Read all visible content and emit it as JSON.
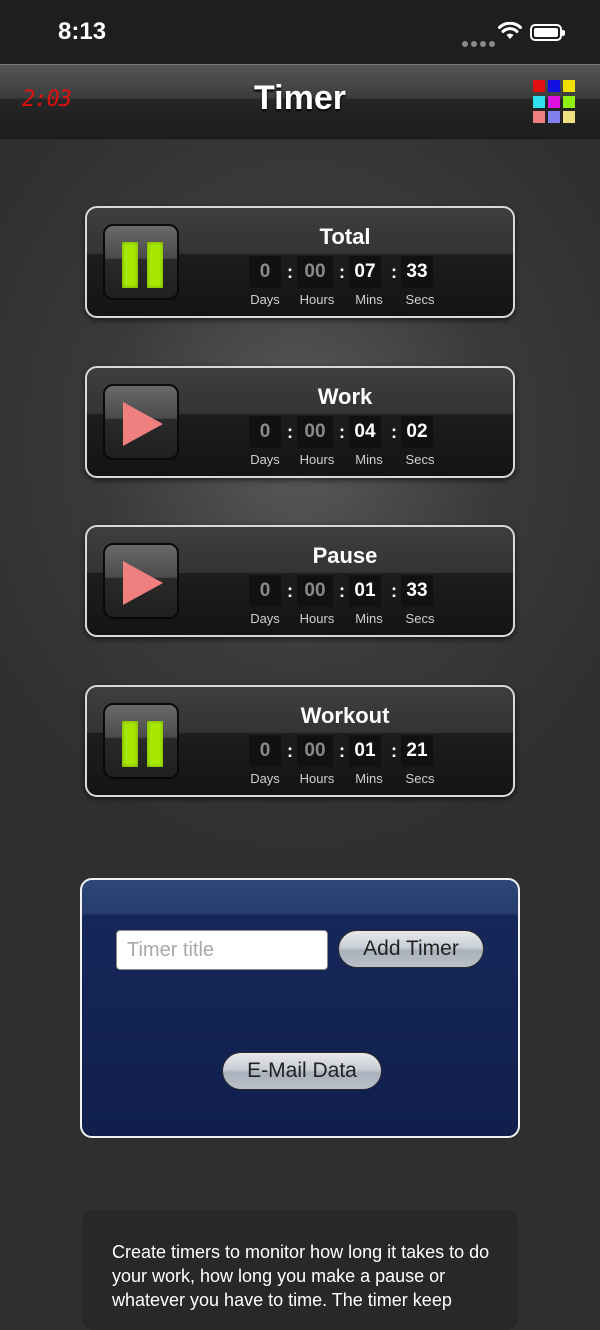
{
  "status_bar": {
    "time": "8:13"
  },
  "nav": {
    "clock": "2:03",
    "title": "Timer",
    "grid_colors": [
      "#e01010",
      "#1010e0",
      "#f0e000",
      "#30e0f0",
      "#e010e0",
      "#90f010",
      "#f08080",
      "#8080f0",
      "#f0e080"
    ]
  },
  "timers": [
    {
      "title": "Total",
      "state": "pause-icon",
      "days": "0",
      "hours": "00",
      "mins": "07",
      "secs": "33"
    },
    {
      "title": "Work",
      "state": "play-icon",
      "days": "0",
      "hours": "00",
      "mins": "04",
      "secs": "02"
    },
    {
      "title": "Pause",
      "state": "play-icon",
      "days": "0",
      "hours": "00",
      "mins": "01",
      "secs": "33"
    },
    {
      "title": "Workout",
      "state": "pause-icon",
      "days": "0",
      "hours": "00",
      "mins": "01",
      "secs": "21"
    }
  ],
  "units": {
    "days": "Days",
    "hours": "Hours",
    "mins": "Mins",
    "secs": "Secs"
  },
  "add_panel": {
    "input_placeholder": "Timer title",
    "add_button": "Add Timer",
    "email_button": "E-Mail Data"
  },
  "info": {
    "text": "Create timers to monitor how long it takes to do your work, how long you make a pause or whatever you have to time. The timer keep"
  }
}
